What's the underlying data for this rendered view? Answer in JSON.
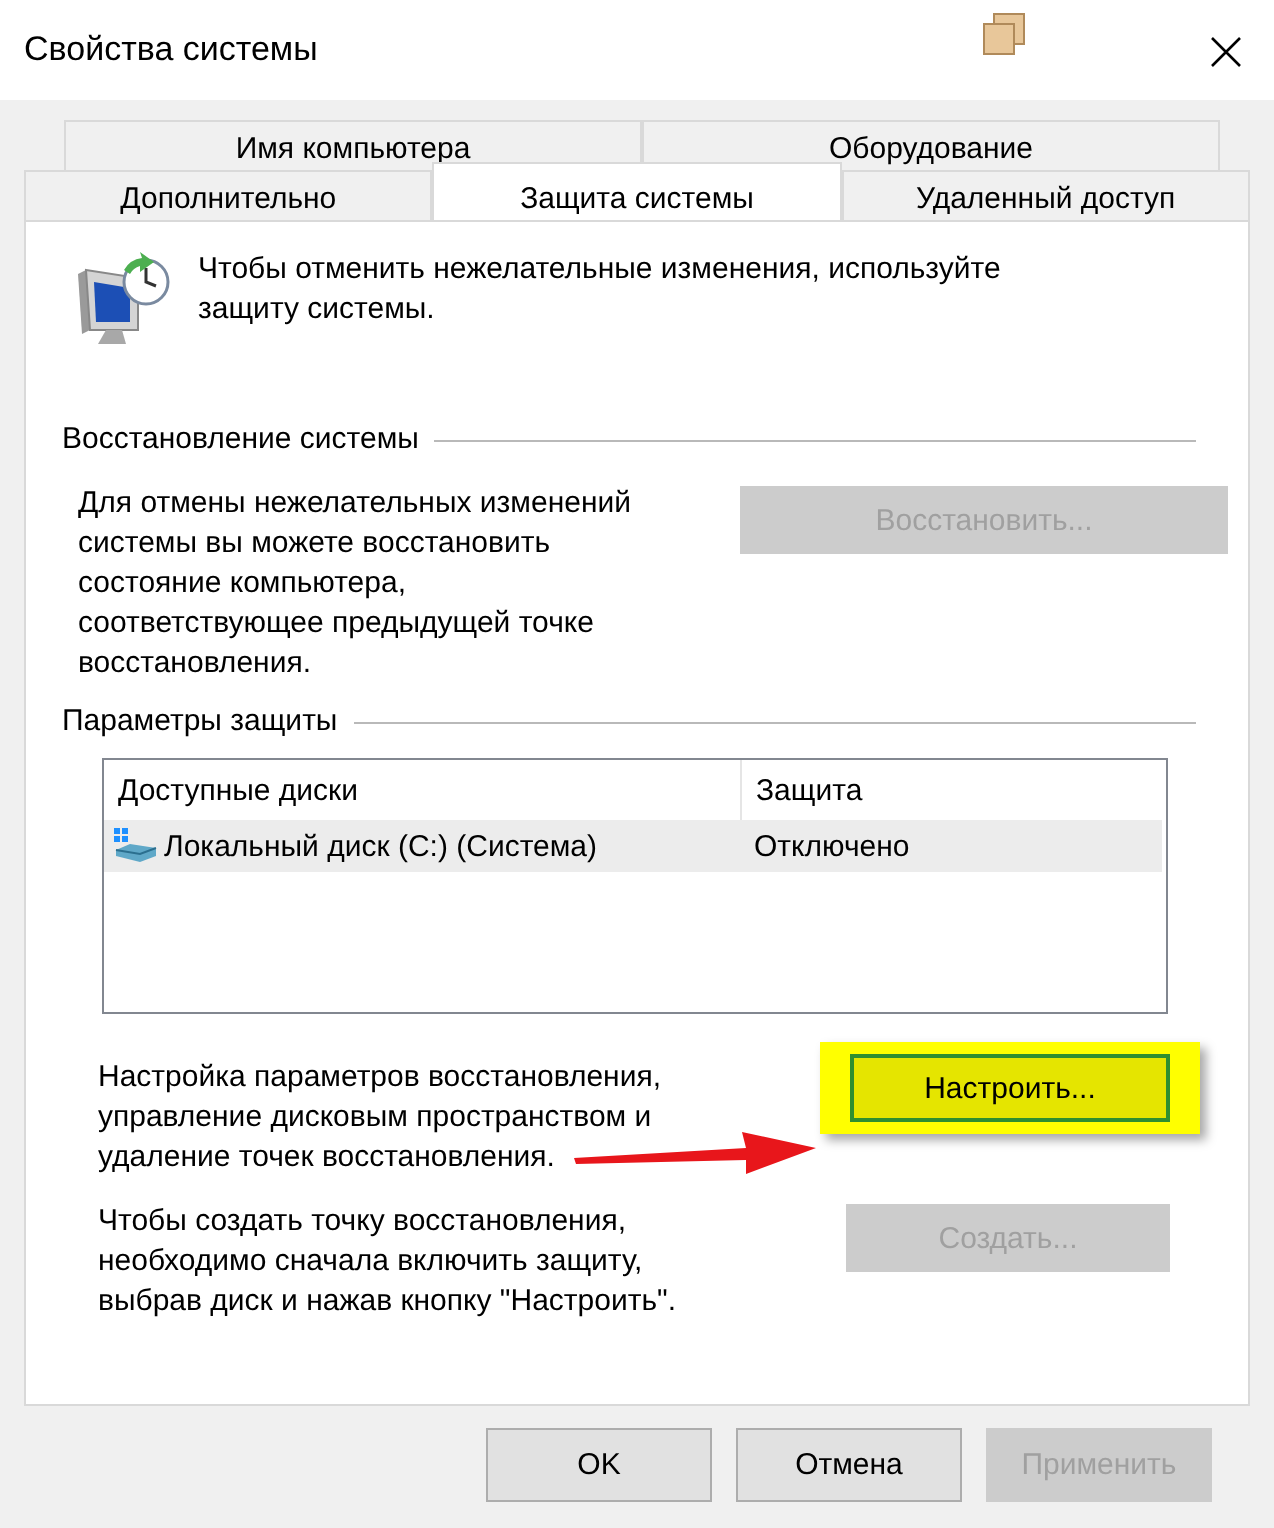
{
  "window": {
    "title": "Свойства системы"
  },
  "tab_rows": [
    {
      "tabs": [
        {
          "label": "Имя компьютера",
          "selected": false
        },
        {
          "label": "Оборудование",
          "selected": false
        }
      ]
    },
    {
      "tabs": [
        {
          "label": "Дополнительно",
          "selected": false
        },
        {
          "label": "Защита системы",
          "selected": true
        },
        {
          "label": "Удаленный доступ",
          "selected": false
        }
      ]
    }
  ],
  "intro": "Чтобы отменить нежелательные изменения, используйте\nзащиту системы.",
  "restore": {
    "heading": "Восстановление системы",
    "description": "Для отмены нежелательных изменений\nсистемы вы можете восстановить\nсостояние компьютера,\nсоответствующее предыдущей точке\nвосстановления.",
    "button": {
      "label": "Восстановить...",
      "disabled": true
    }
  },
  "protection": {
    "heading": "Параметры защиты",
    "table": {
      "columns": [
        "Доступные диски",
        "Защита"
      ],
      "rows": [
        {
          "cells": [
            "Локальный диск (C:) (Система)",
            "Отключено"
          ],
          "selected": true
        }
      ]
    },
    "configure": {
      "description": "Настройка параметров восстановления,\nуправление дисковым пространством и\nудаление точек восстановления.",
      "button": {
        "label": "Настроить...",
        "disabled": false,
        "highlighted": true
      }
    },
    "create": {
      "description": "Чтобы создать точку восстановления,\nнеобходимо сначала включить защиту,\nвыбрав диск и нажав кнопку \"Настроить\".",
      "button": {
        "label": "Создать...",
        "disabled": true
      }
    }
  },
  "buttons": [
    {
      "label": "OK",
      "disabled": false
    },
    {
      "label": "Отмена",
      "disabled": false
    },
    {
      "label": "Применить",
      "disabled": true
    }
  ]
}
